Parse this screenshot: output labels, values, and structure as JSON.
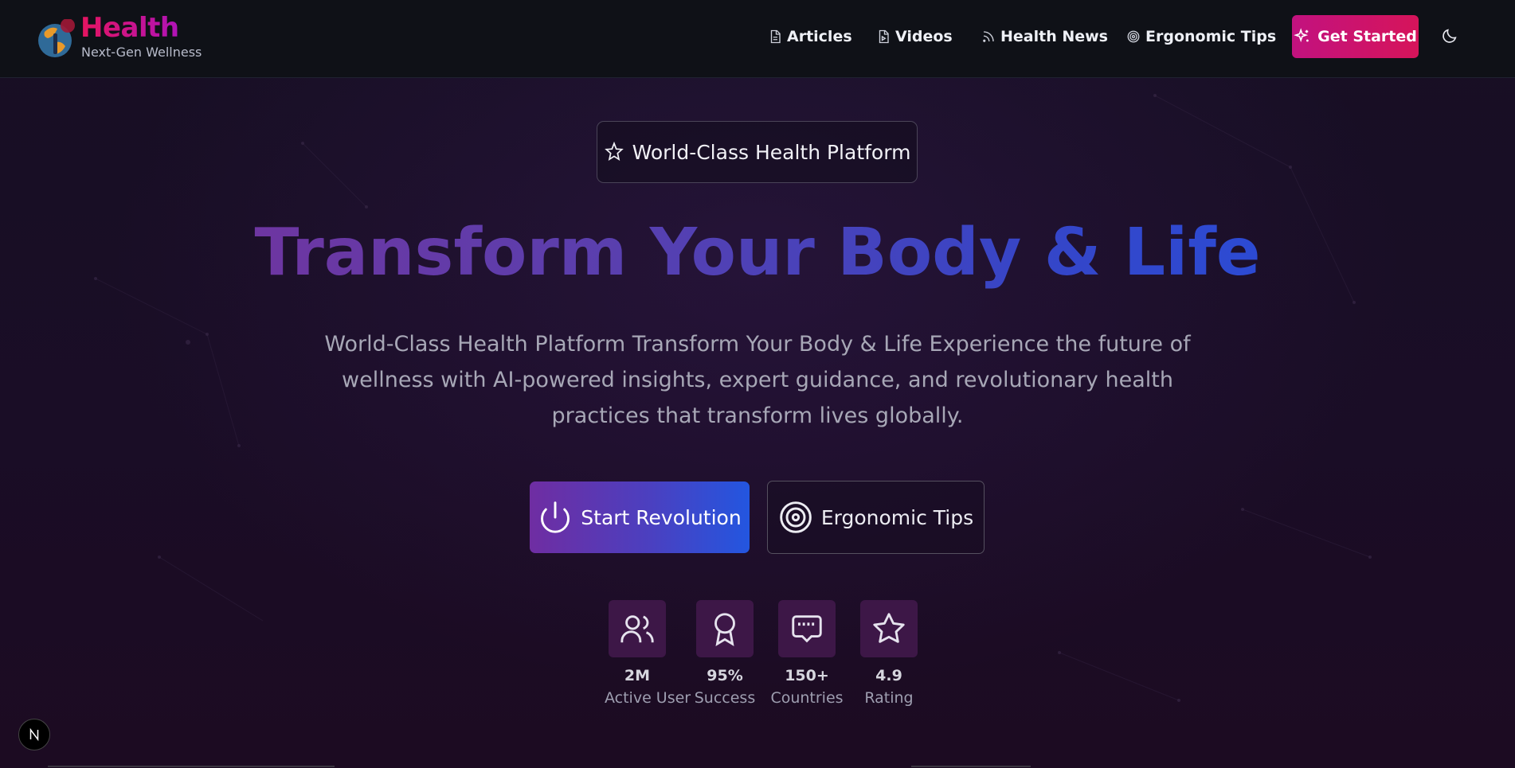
{
  "brand": {
    "title": "Health",
    "subtitle": "Next-Gen Wellness"
  },
  "nav": {
    "links": [
      {
        "label": "Articles",
        "icon": "document-icon"
      },
      {
        "label": "Videos",
        "icon": "video-file-icon"
      },
      {
        "label": "Health News",
        "icon": "rss-icon"
      },
      {
        "label": "Ergonomic Tips",
        "icon": "target-icon"
      }
    ],
    "cta_label": "Get Started",
    "theme_icon": "moon-icon"
  },
  "hero": {
    "badge": "World-Class Health Platform",
    "title": "Transform Your Body & Life",
    "description": "World-Class Health Platform Transform Your Body & Life Experience the future of wellness with AI-powered insights, expert guidance, and revolutionary health practices that transform lives globally.",
    "primary_button": "Start Revolution",
    "secondary_button": "Ergonomic Tips"
  },
  "stats": [
    {
      "value": "2M",
      "label": "Active User",
      "icon": "users-icon"
    },
    {
      "value": "95%",
      "label": "Success",
      "icon": "award-icon"
    },
    {
      "value": "150+",
      "label": "Countries",
      "icon": "ethernet-port-icon"
    },
    {
      "value": "4.9",
      "label": "Rating",
      "icon": "star-icon"
    }
  ],
  "colors": {
    "background": "#150c1f",
    "nav_background": "#0f1117",
    "brand_pink": "#d4146e",
    "cta": "#c2127f",
    "primary_gradient_start": "#6f2da2",
    "primary_gradient_end": "#2356e0",
    "stat_box": "#3d1747"
  }
}
